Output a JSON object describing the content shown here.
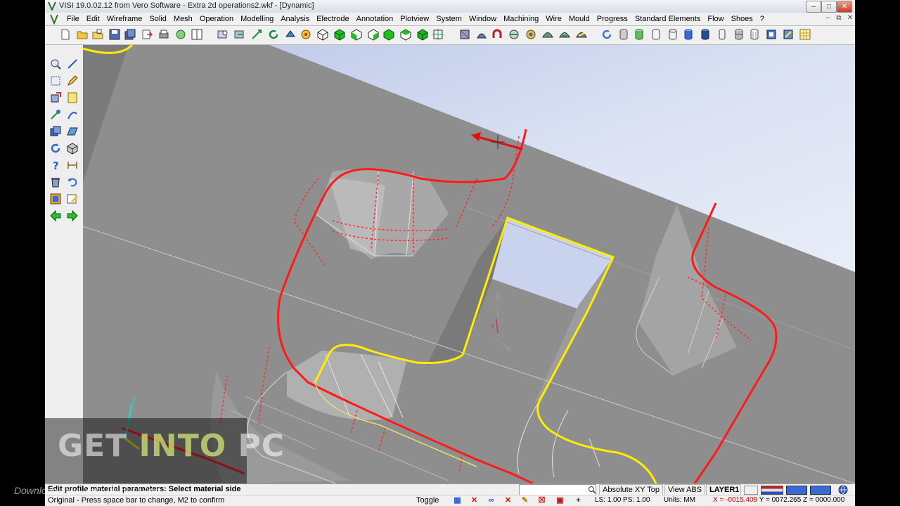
{
  "window": {
    "title": "VISI 19.0.02.12 from Vero Software - Extra 2d operations2.wkf - [Dynamic]"
  },
  "menu": {
    "items": [
      "File",
      "Edit",
      "Wireframe",
      "Solid",
      "Mesh",
      "Operation",
      "Modelling",
      "Analysis",
      "Electrode",
      "Annotation",
      "Plotview",
      "System",
      "Window",
      "Machining",
      "Wire",
      "Mould",
      "Progress",
      "Standard Elements",
      "Flow",
      "Shoes",
      "?"
    ]
  },
  "viewport": {
    "triad_labels": {
      "z": "Z",
      "y": "Y",
      "x": "X"
    },
    "colors": {
      "selected_profile": "#ff1a1a",
      "highlight_profile": "#ffee00",
      "background_top": "#b9c6e8",
      "solid_face": "#8a8a8a"
    }
  },
  "watermark": {
    "left": "GET ",
    "mid": "INTO",
    "right": " PC",
    "tagline": "Download Free Your Desired App"
  },
  "status": {
    "prompt_line1": "Edit profile material parameters: Select material side",
    "prompt_line2": "Original - Press space bar to change, M2 to confirm",
    "search_value": "",
    "view_mode": "Absolute XY Top",
    "view_abs": "View ABS",
    "layer": "LAYER1",
    "toggle": "Toggle",
    "ls_ps": "LS: 1.00 PS: 1.00",
    "units": "Units: MM",
    "coord_x": "X = -0015.409",
    "coord_yz": " Y = 0072.265 Z = 0000.000"
  }
}
